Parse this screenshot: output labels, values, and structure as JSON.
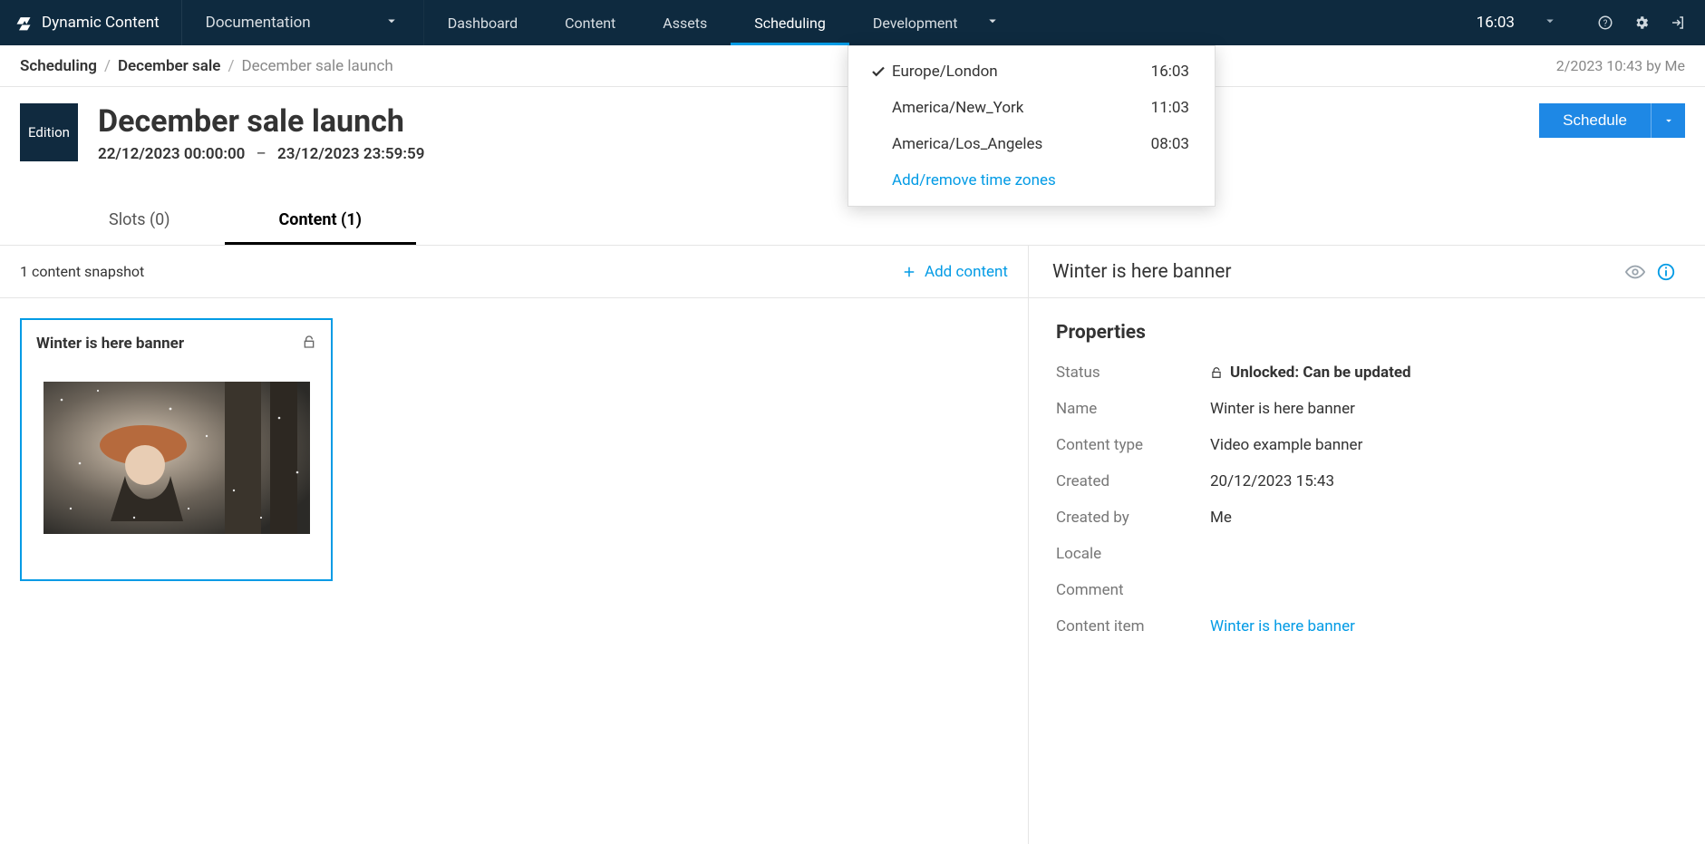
{
  "brand": "Dynamic Content",
  "topnav": {
    "documentation": "Documentation",
    "links": {
      "dashboard": "Dashboard",
      "content": "Content",
      "assets": "Assets",
      "scheduling": "Scheduling",
      "development": "Development"
    },
    "clock": "16:03"
  },
  "timezones": {
    "items": [
      {
        "name": "Europe/London",
        "time": "16:03",
        "selected": true
      },
      {
        "name": "America/New_York",
        "time": "11:03",
        "selected": false
      },
      {
        "name": "America/Los_Angeles",
        "time": "08:03",
        "selected": false
      }
    ],
    "manage": "Add/remove time zones"
  },
  "breadcrumb": {
    "root": "Scheduling",
    "event": "December sale",
    "current": "December sale launch",
    "saved": "2/2023 10:43 by Me"
  },
  "edition": {
    "badge": "Edition",
    "title": "December sale launch",
    "start": "22/12/2023 00:00:00",
    "end": "23/12/2023 23:59:59",
    "scheduleBtn": "Schedule"
  },
  "tabs": {
    "slots": "Slots (0)",
    "content": "Content (1)"
  },
  "left": {
    "snapshotCount": "1 content snapshot",
    "addContent": "Add content",
    "card": {
      "title": "Winter is here banner"
    }
  },
  "right": {
    "title": "Winter is here banner",
    "propsTitle": "Properties",
    "labels": {
      "status": "Status",
      "name": "Name",
      "ctype": "Content type",
      "created": "Created",
      "createdBy": "Created by",
      "locale": "Locale",
      "comment": "Comment",
      "citem": "Content item"
    },
    "values": {
      "status": "Unlocked: Can be updated",
      "name": "Winter is here banner",
      "ctype": "Video example banner",
      "created": "20/12/2023 15:43",
      "createdBy": "Me",
      "locale": "",
      "comment": "",
      "citem": "Winter is here banner"
    }
  }
}
